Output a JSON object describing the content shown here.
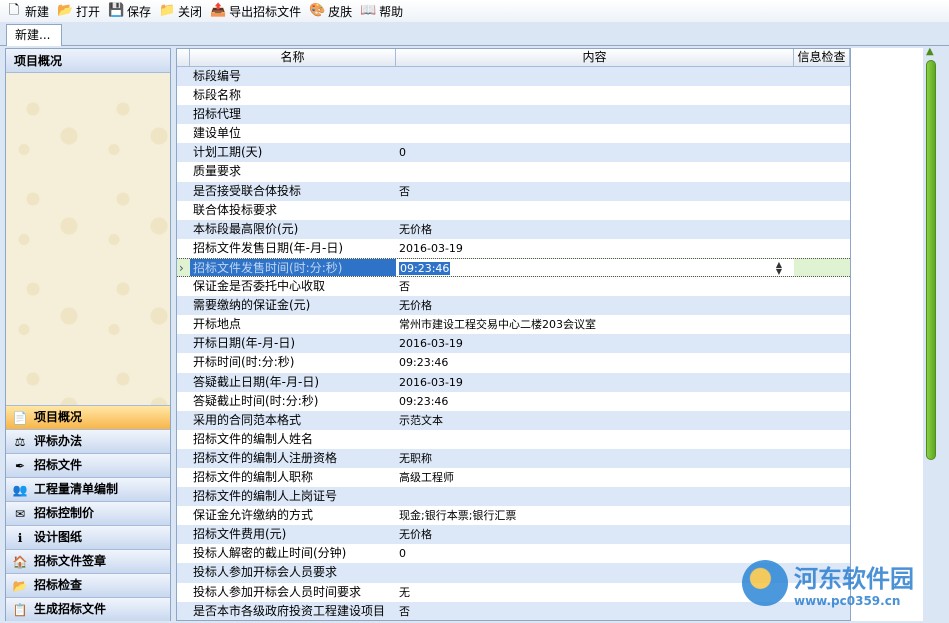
{
  "toolbar": {
    "items": [
      {
        "label": "新建",
        "icon": "new-file-icon",
        "glyph": "🗋"
      },
      {
        "label": "打开",
        "icon": "open-folder-icon",
        "glyph": "📂"
      },
      {
        "label": "保存",
        "icon": "save-icon",
        "glyph": "💾"
      },
      {
        "label": "关闭",
        "icon": "close-folder-icon",
        "glyph": "📁"
      },
      {
        "label": "导出招标文件",
        "icon": "export-icon",
        "glyph": "📤"
      },
      {
        "label": "皮肤",
        "icon": "skin-icon",
        "glyph": "🎨"
      },
      {
        "label": "帮助",
        "icon": "help-icon",
        "glyph": "📖"
      }
    ]
  },
  "tab": {
    "label": "新建..."
  },
  "left_panel": {
    "header": "项目概况",
    "nav": [
      {
        "label": "项目概况",
        "icon": "document-icon",
        "glyph": "📄",
        "active": true
      },
      {
        "label": "评标办法",
        "icon": "gavel-icon",
        "glyph": "⚖"
      },
      {
        "label": "招标文件",
        "icon": "pen-icon",
        "glyph": "✒"
      },
      {
        "label": "工程量清单编制",
        "icon": "users-icon",
        "glyph": "👥"
      },
      {
        "label": "招标控制价",
        "icon": "envelope-icon",
        "glyph": "✉"
      },
      {
        "label": "设计图纸",
        "icon": "info-icon",
        "glyph": "ℹ"
      },
      {
        "label": "招标文件签章",
        "icon": "house-icon",
        "glyph": "🏠"
      },
      {
        "label": "招标检查",
        "icon": "folder-icon",
        "glyph": "📂"
      },
      {
        "label": "生成招标文件",
        "icon": "list-icon",
        "glyph": "📋"
      }
    ]
  },
  "grid": {
    "columns": [
      "名称",
      "内容",
      "信息检查"
    ],
    "rows": [
      {
        "name": "标段编号",
        "content": ""
      },
      {
        "name": "标段名称",
        "content": ""
      },
      {
        "name": "招标代理",
        "content": ""
      },
      {
        "name": "建设单位",
        "content": ""
      },
      {
        "name": "计划工期(天)",
        "content": "0"
      },
      {
        "name": "质量要求",
        "content": ""
      },
      {
        "name": "是否接受联合体投标",
        "content": "否"
      },
      {
        "name": "联合体投标要求",
        "content": ""
      },
      {
        "name": "本标段最高限价(元)",
        "content": "无价格"
      },
      {
        "name": "招标文件发售日期(年-月-日)",
        "content": "2016-03-19"
      },
      {
        "name": "招标文件发售时间(时:分:秒)",
        "content": "09:23:46",
        "selected": true
      },
      {
        "name": "保证金是否委托中心收取",
        "content": "否"
      },
      {
        "name": "需要缴纳的保证金(元)",
        "content": "无价格"
      },
      {
        "name": "开标地点",
        "content": "常州市建设工程交易中心二楼203会议室"
      },
      {
        "name": "开标日期(年-月-日)",
        "content": "2016-03-19"
      },
      {
        "name": "开标时间(时:分:秒)",
        "content": "09:23:46"
      },
      {
        "name": "答疑截止日期(年-月-日)",
        "content": "2016-03-19"
      },
      {
        "name": "答疑截止时间(时:分:秒)",
        "content": "09:23:46"
      },
      {
        "name": "采用的合同范本格式",
        "content": "示范文本"
      },
      {
        "name": "招标文件的编制人姓名",
        "content": ""
      },
      {
        "name": "招标文件的编制人注册资格",
        "content": "无职称"
      },
      {
        "name": "招标文件的编制人职称",
        "content": "高级工程师"
      },
      {
        "name": "招标文件的编制人上岗证号",
        "content": ""
      },
      {
        "name": "保证金允许缴纳的方式",
        "content": "现金;银行本票;银行汇票"
      },
      {
        "name": "招标文件费用(元)",
        "content": "无价格"
      },
      {
        "name": "投标人解密的截止时间(分钟)",
        "content": "0"
      },
      {
        "name": "投标人参加开标会人员要求",
        "content": ""
      },
      {
        "name": "投标人参加开标会人员时间要求",
        "content": "无"
      },
      {
        "name": "是否本市各级政府投资工程建设项目",
        "content": "否"
      }
    ]
  },
  "watermark": {
    "title": "河东软件园",
    "url": "www.pc0359.cn"
  }
}
